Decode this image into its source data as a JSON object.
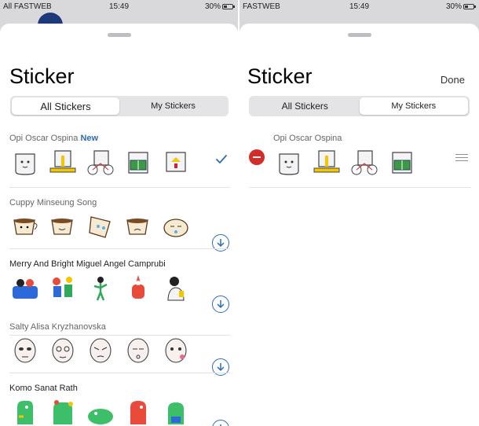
{
  "left": {
    "status": {
      "carrier": "All FASTWEB",
      "time": "15:49",
      "battery": "30%"
    },
    "title": "Sticker",
    "segments": {
      "all": "All Stickers",
      "mine": "My Stickers"
    },
    "packs": [
      {
        "name": "Opi Oscar Ospina",
        "badge": "New",
        "action": "added"
      },
      {
        "name": "Cuppy Minseung Song",
        "action": "download"
      },
      {
        "name": "Merry And Bright Miguel Angel Camprubi",
        "action": "download"
      },
      {
        "name": "Salty Alisa Kryzhanovska",
        "action": "download"
      },
      {
        "name": "Komo Sanat Rath",
        "action": "download"
      }
    ]
  },
  "right": {
    "status": {
      "carrier": "FASTWEB",
      "time": "15:49",
      "battery": "30%"
    },
    "title": "Sticker",
    "done_label": "Done",
    "segments": {
      "all": "All Stickers",
      "mine": "My Stickers"
    },
    "packs": [
      {
        "name": "Opi Oscar Ospina"
      }
    ]
  },
  "colors": {
    "accent": "#2f6ab5",
    "remove": "#d42b2b",
    "sheet": "#ffffff",
    "backdrop": "#d9d9dc"
  },
  "icons": {
    "check": "checkmark-icon",
    "download": "download-circle-icon",
    "remove": "remove-circle-icon",
    "reorder": "reorder-handle-icon"
  }
}
